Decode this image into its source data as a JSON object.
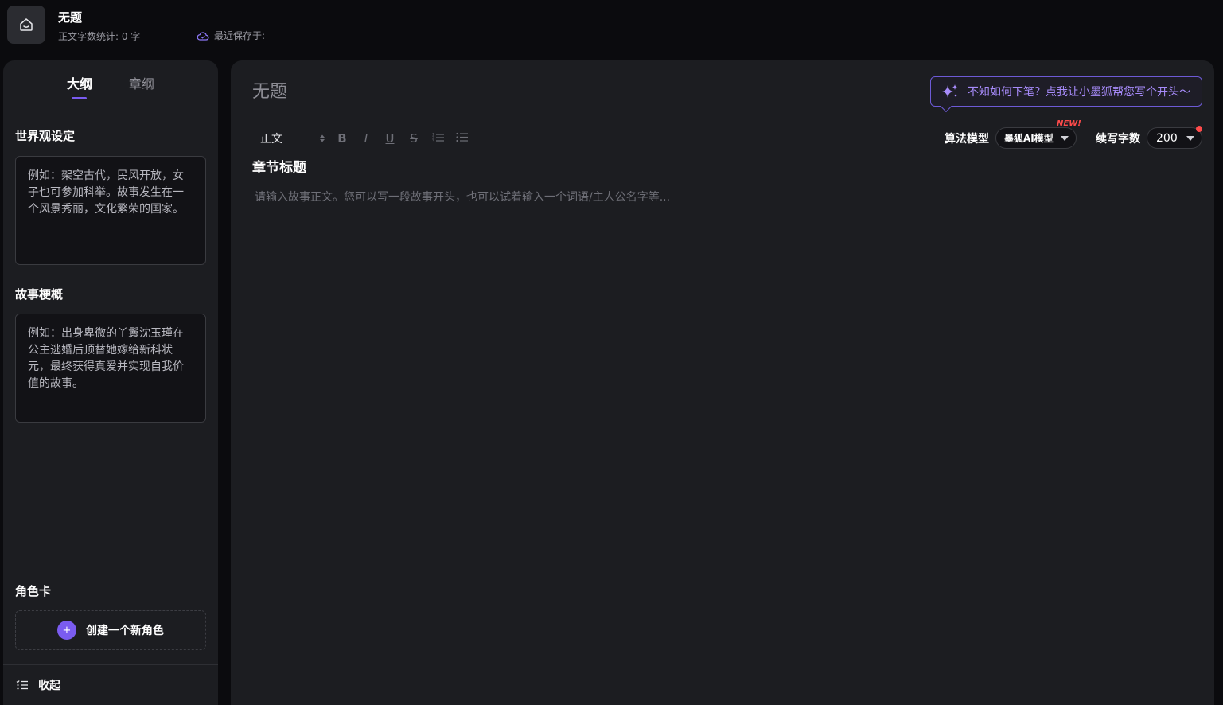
{
  "header": {
    "title": "无题",
    "word_count": "正文字数统计: 0 字",
    "save_status": "最近保存于:"
  },
  "sidebar": {
    "tabs": [
      {
        "label": "大纲",
        "active": true
      },
      {
        "label": "章纲",
        "active": false
      }
    ],
    "world_setting": {
      "label": "世界观设定",
      "placeholder": "例如：架空古代，民风开放，女子也可参加科举。故事发生在一个风景秀丽，文化繁荣的国家。"
    },
    "story_outline": {
      "label": "故事梗概",
      "placeholder": "例如：出身卑微的丫鬟沈玉瑾在公主逃婚后顶替她嫁给新科状元，最终获得真爱并实现自我价值的故事。"
    },
    "role_card": {
      "label": "角色卡",
      "create_label": "创建一个新角色",
      "plus": "+"
    },
    "collapse_label": "收起"
  },
  "editor": {
    "title": "无题",
    "ai_prompt": "不知如何下笔？点我让小墨狐帮您写个开头～",
    "toolbar": {
      "style_value": "正文",
      "bold": "B",
      "italic": "I",
      "underline": "U",
      "strike": "S"
    },
    "model": {
      "label": "算法模型",
      "value": "墨狐AI模型",
      "badge": "NEW!"
    },
    "continue_count": {
      "label": "续写字数",
      "value": "200"
    },
    "chapter_title": "章节标题",
    "body_placeholder": "请输入故事正文。您可以写一段故事开头，也可以试着输入一个词语/主人公名字等..."
  },
  "colors": {
    "accent": "#7a5cf0",
    "badge_red": "#ff4b4b",
    "panel": "#1c1d21",
    "background": "#0b0b0e"
  }
}
